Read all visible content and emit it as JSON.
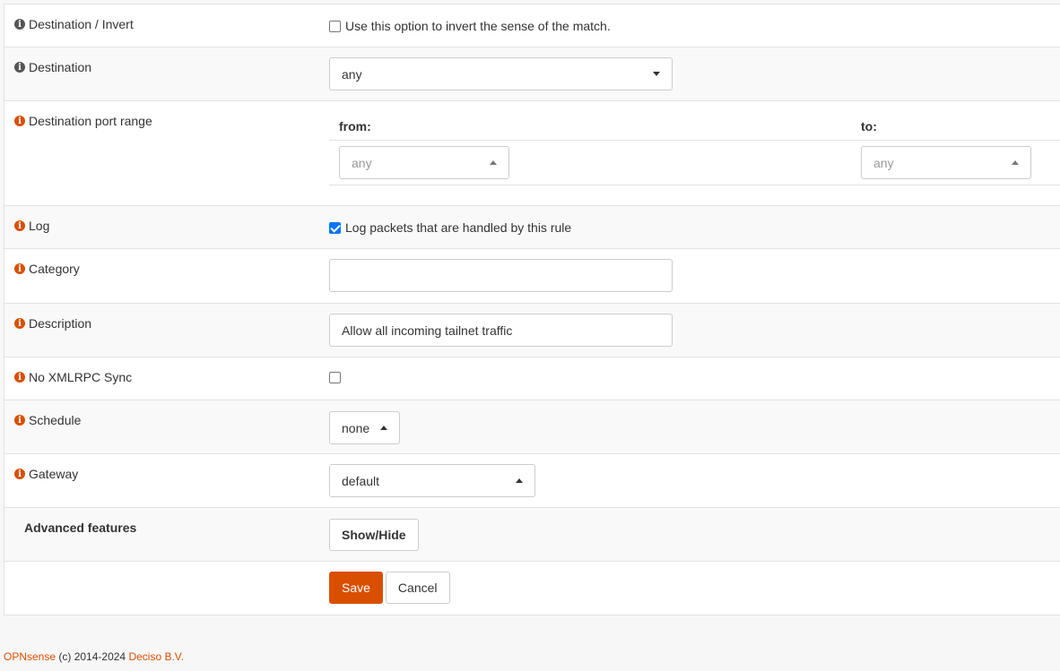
{
  "rows": {
    "destination_invert": {
      "label": "Destination / Invert",
      "checkbox_text": "Use this option to invert the sense of the match.",
      "checked": false
    },
    "destination": {
      "label": "Destination",
      "value": "any"
    },
    "dest_port_range": {
      "label": "Destination port range",
      "from_label": "from:",
      "to_label": "to:",
      "from_value": "any",
      "to_value": "any"
    },
    "log": {
      "label": "Log",
      "checkbox_text": "Log packets that are handled by this rule",
      "checked": true
    },
    "category": {
      "label": "Category",
      "value": ""
    },
    "description": {
      "label": "Description",
      "value": "Allow all incoming tailnet traffic"
    },
    "no_xmlrpc": {
      "label": "No XMLRPC Sync",
      "checked": false
    },
    "schedule": {
      "label": "Schedule",
      "value": "none"
    },
    "gateway": {
      "label": "Gateway",
      "value": "default"
    },
    "advanced": {
      "label": "Advanced features",
      "button": "Show/Hide"
    }
  },
  "actions": {
    "save": "Save",
    "cancel": "Cancel"
  },
  "footer": {
    "brand": "OPNsense",
    "copyright": "(c) 2014-2024",
    "company": "Deciso B.V."
  },
  "colors": {
    "accent": "#d94f00",
    "checkbox_checked": "#0075ff"
  },
  "icons": [
    "info-icon",
    "caret-down-icon",
    "caret-up-icon",
    "checkbox-icon"
  ]
}
